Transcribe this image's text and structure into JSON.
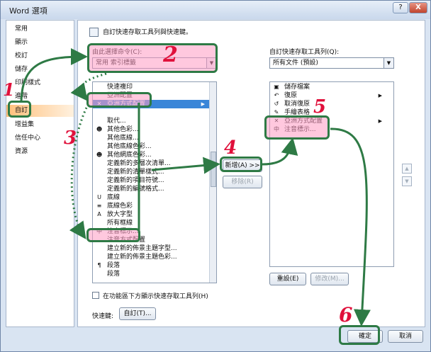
{
  "window": {
    "title": "Word 選項",
    "help_glyph": "?",
    "close_glyph": "X"
  },
  "nav": {
    "items": [
      "常用",
      "顯示",
      "校訂",
      "儲存",
      "印刷樣式",
      "進階",
      "自訂",
      "增益集",
      "信任中心",
      "資源"
    ],
    "selected": "自訂"
  },
  "content": {
    "heading": "自訂快速存取工具列與快速鍵。",
    "choose_label": "由此選擇命令(C):",
    "choose_value": "常用 索引標籤",
    "customize_label": "自訂快速存取工具列(Q):",
    "customize_value": "所有文件 (預設)",
    "left_items": [
      {
        "icon": "",
        "text": "快速複印"
      },
      {
        "icon": "",
        "text": "亞洲配置"
      },
      {
        "icon": "✕",
        "text": "亞洲方式配置",
        "submenu": true
      },
      {
        "icon": "",
        "text": ""
      },
      {
        "icon": "",
        "text": "取代..."
      },
      {
        "icon": "☻",
        "text": "其他色彩..."
      },
      {
        "icon": "",
        "text": "其他底線..."
      },
      {
        "icon": "",
        "text": "其他底線色彩..."
      },
      {
        "icon": "☻",
        "text": "其他網底色彩..."
      },
      {
        "icon": "",
        "text": "定義新的多層次清單..."
      },
      {
        "icon": "",
        "text": "定義新的清單樣式..."
      },
      {
        "icon": "",
        "text": "定義新的項目符號..."
      },
      {
        "icon": "",
        "text": "定義新的編號格式..."
      },
      {
        "icon": "U",
        "text": "底線"
      },
      {
        "icon": "≡",
        "text": "底線色彩"
      },
      {
        "icon": "A",
        "text": "放大字型"
      },
      {
        "icon": "",
        "text": "所有框線"
      },
      {
        "icon": "中",
        "text": "注音標示..."
      },
      {
        "icon": "",
        "text": "注音方式配置"
      },
      {
        "icon": "",
        "text": "建立新的佈景主題字型..."
      },
      {
        "icon": "",
        "text": "建立新的佈景主題色彩..."
      },
      {
        "icon": "¶",
        "text": "段落"
      },
      {
        "icon": "",
        "text": "段落"
      }
    ],
    "right_items": [
      {
        "icon": "▣",
        "text": "儲存檔案"
      },
      {
        "icon": "↶",
        "text": "復原",
        "submenu": true
      },
      {
        "icon": "↺",
        "text": "取消復原"
      },
      {
        "icon": "✎",
        "text": "手繪表格"
      },
      {
        "icon": "✕",
        "text": "亞洲方式配置",
        "submenu": true
      },
      {
        "icon": "中",
        "text": "注音標示..."
      }
    ],
    "add_button": "新增(A) >>",
    "remove_button": "移除(R)",
    "reset_button": "重設(E)",
    "modify_button": "修改(M)...",
    "show_below_label": "在功能區下方顯示快速存取工具列(H)",
    "shortcut_label": "快速鍵:",
    "customize_button": "自訂(T)...",
    "up_glyph": "▲",
    "down_glyph": "▼"
  },
  "footer": {
    "ok_button": "確定",
    "cancel_button": "取消"
  },
  "annotations": {
    "steps": [
      "1",
      "2",
      "3",
      "4",
      "5",
      "6"
    ],
    "color": "#e0103b",
    "ring_color": "#2e7a45"
  }
}
